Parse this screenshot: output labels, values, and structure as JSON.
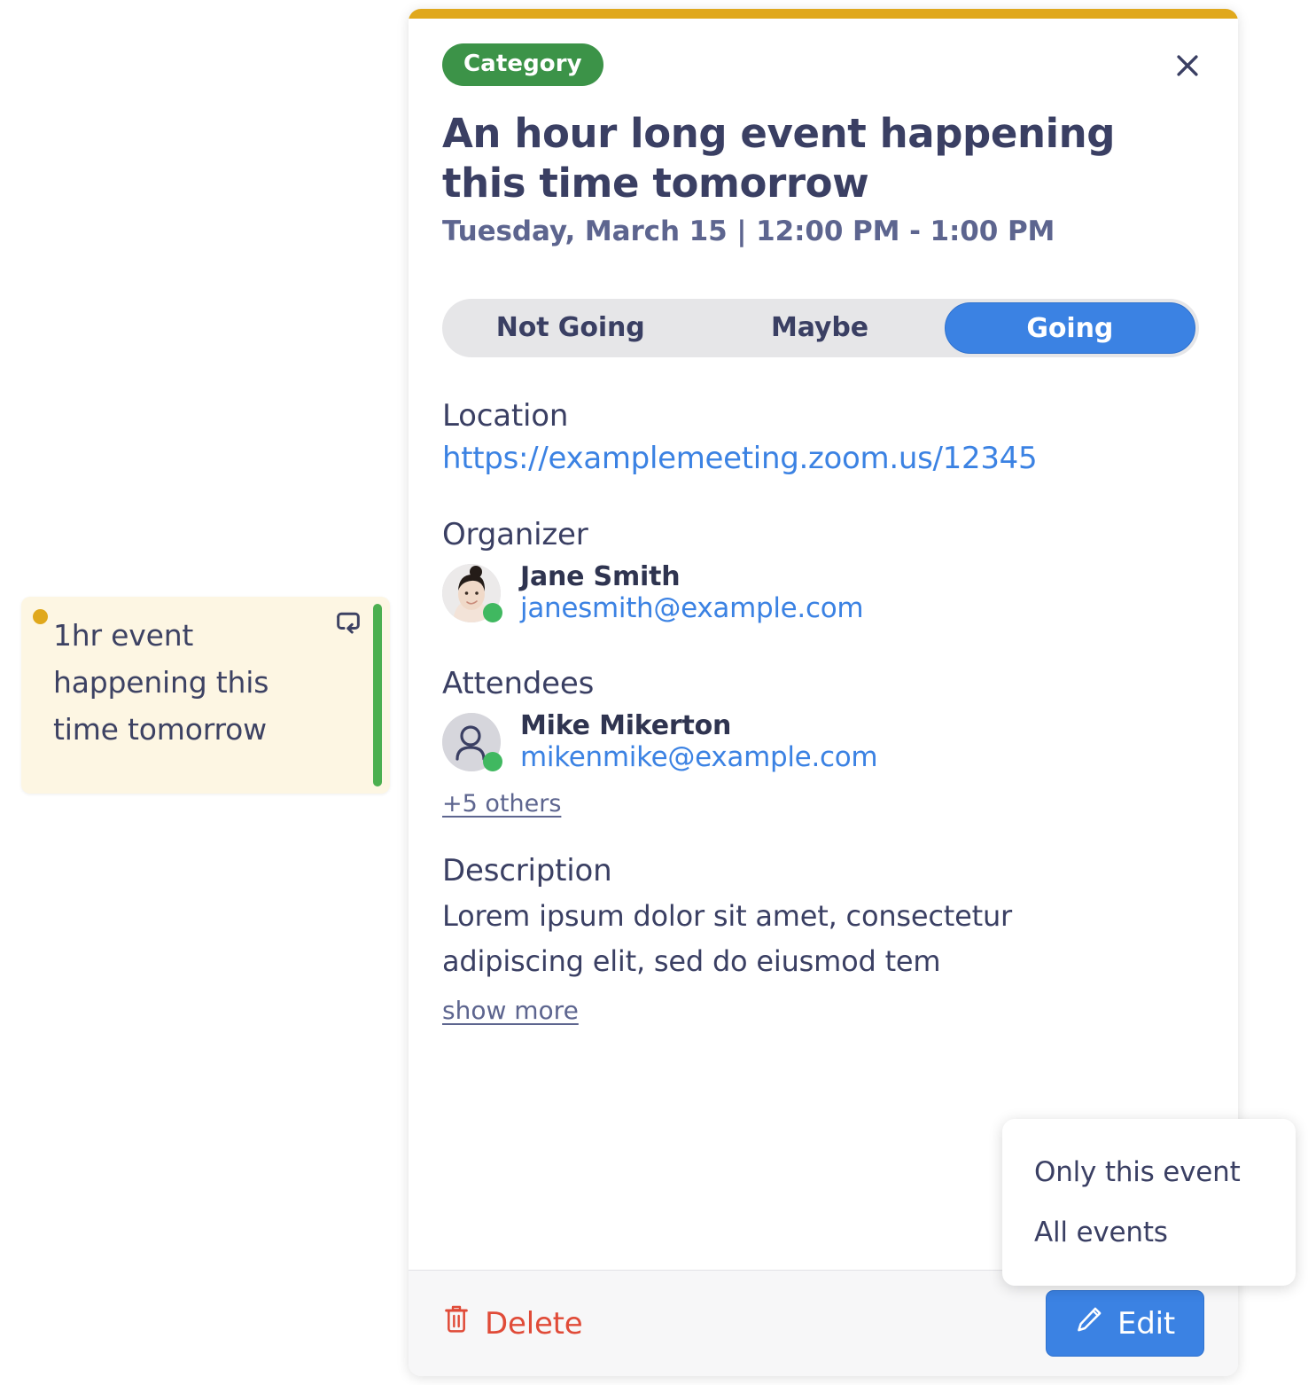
{
  "event_chip": {
    "title": "1hr event happening this time tomorrow",
    "dot_color": "#e0a81c",
    "strip_color": "#4caf50",
    "background": "#fdf6e3",
    "repeat_icon": "repeat-icon"
  },
  "card": {
    "accent_color": "#e0a81c",
    "category_badge": "Category",
    "category_color": "#3c9348",
    "close_icon": "close-icon",
    "title": "An hour long event happening this time tomorrow",
    "datetime": "Tuesday, March 15 | 12:00 PM - 1:00 PM",
    "rsvp": {
      "options": [
        "Not Going",
        "Maybe",
        "Going"
      ],
      "selected": "Going",
      "selected_color": "#3b82e3"
    },
    "location": {
      "label": "Location",
      "url": "https://examplemeeting.zoom.us/12345"
    },
    "organizer": {
      "label": "Organizer",
      "name": "Jane Smith",
      "email": "janesmith@example.com",
      "status": "online",
      "avatar": "photo-avatar"
    },
    "attendees": {
      "label": "Attendees",
      "people": [
        {
          "name": "Mike Mikerton",
          "email": "mikenmike@example.com",
          "status": "online",
          "avatar": "person-icon"
        }
      ],
      "more_link": "+5 others"
    },
    "description": {
      "label": "Description",
      "text": "Lorem ipsum dolor sit amet, consectetur adipiscing elit, sed do eiusmod tem",
      "show_more": "show more"
    },
    "footer": {
      "delete_label": "Delete",
      "delete_icon": "trash-icon",
      "delete_color": "#e04b38",
      "edit_label": "Edit",
      "edit_icon": "pencil-icon",
      "edit_color": "#3b82e3"
    }
  },
  "dropdown": {
    "items": [
      "Only this event",
      "All events"
    ]
  }
}
